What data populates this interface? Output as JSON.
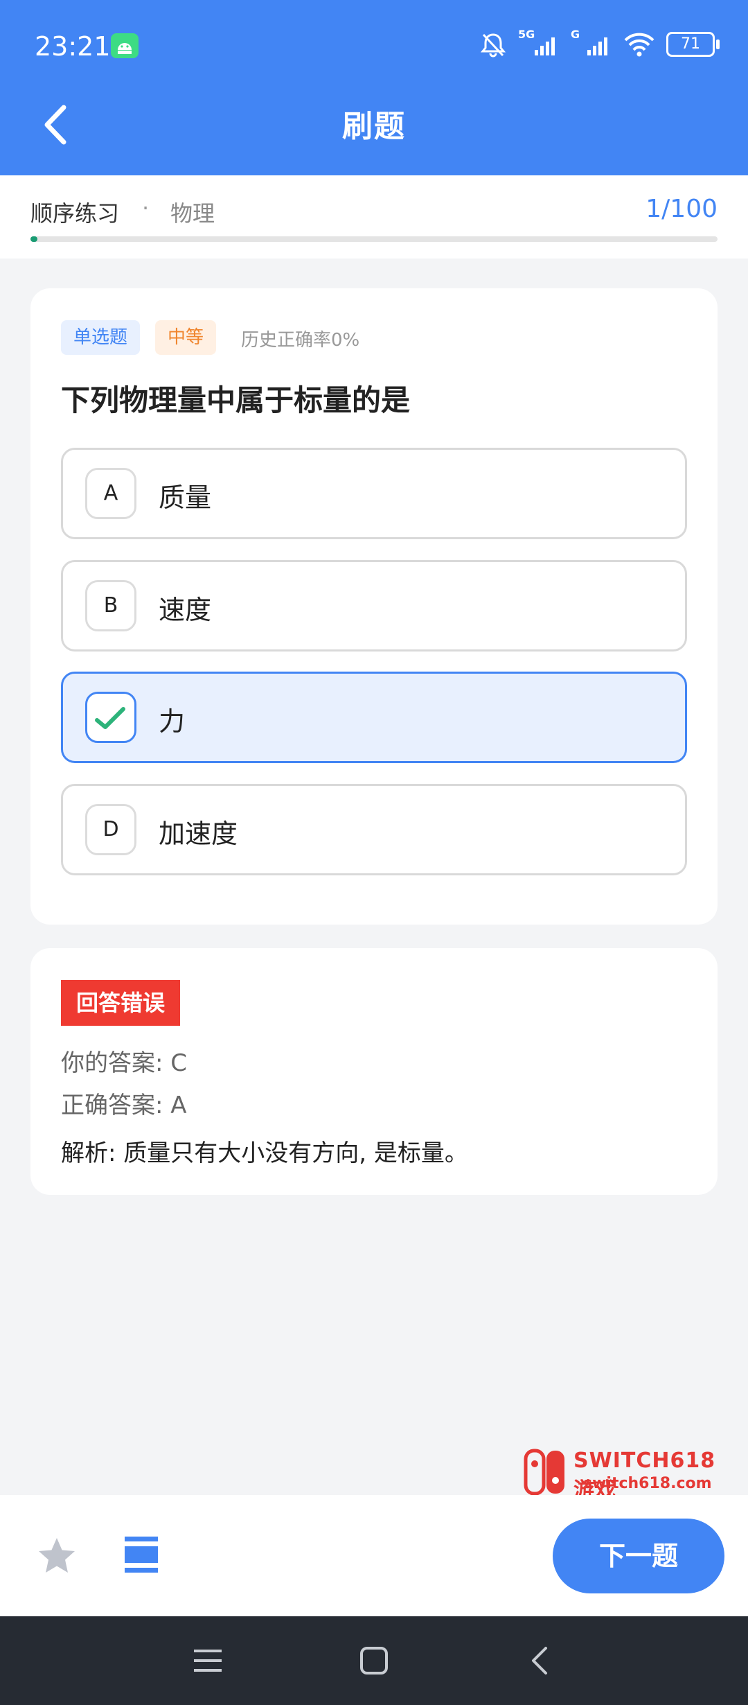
{
  "status_bar": {
    "time": "23:21",
    "network_5g": "5G",
    "network_g": "G",
    "battery": "71"
  },
  "header": {
    "title": "刷题"
  },
  "progress": {
    "mode": "顺序练习",
    "separator": "·",
    "subject": "物理",
    "counter": "1/100",
    "fraction": 0.01
  },
  "question": {
    "type_tag": "单选题",
    "difficulty_tag": "中等",
    "history_accuracy": "历史正确率0%",
    "text": "下列物理量中属于标量的是",
    "options": [
      {
        "letter": "A",
        "text": "质量"
      },
      {
        "letter": "B",
        "text": "速度"
      },
      {
        "letter": "C",
        "text": "力"
      },
      {
        "letter": "D",
        "text": "加速度"
      }
    ]
  },
  "result": {
    "badge": "回答错误",
    "your_answer": "你的答案: C",
    "correct_answer": "正确答案: A",
    "analysis": "解析: 质量只有大小没有方向, 是标量。"
  },
  "bottom": {
    "next_label": "下一题"
  },
  "watermark": {
    "title": "SWITCH618游戏",
    "url": "switch618.com"
  },
  "colors": {
    "primary": "#4285f4",
    "error": "#ef3a31",
    "progress": "#1a9c73"
  },
  "icons": [
    "back-arrow-icon",
    "star-icon",
    "list-icon",
    "menu-icon",
    "home-icon",
    "nav-back-icon",
    "check-icon",
    "bell-off-icon",
    "wifi-icon",
    "battery-icon"
  ]
}
